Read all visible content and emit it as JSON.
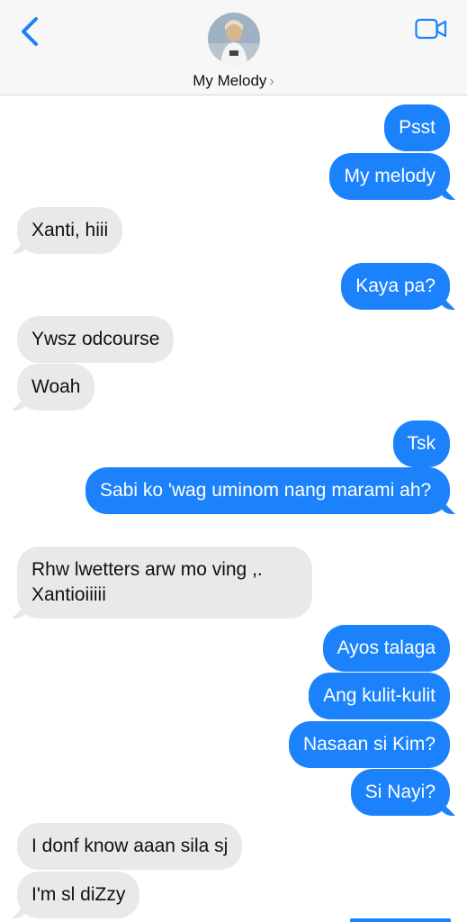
{
  "header": {
    "contact_name": "My Melody",
    "chevron": "›",
    "back_icon": "chevron-left-icon",
    "video_icon": "video-camera-icon",
    "accent": "#1b82fb"
  },
  "messages": [
    {
      "from": "me",
      "text": "Psst"
    },
    {
      "from": "me",
      "text": "My melody"
    },
    {
      "from": "them",
      "text": "Xanti, hiii"
    },
    {
      "from": "me",
      "text": "Kaya pa?"
    },
    {
      "from": "them",
      "text": "Ywsz odcourse"
    },
    {
      "from": "them",
      "text": "Woah"
    },
    {
      "from": "me",
      "text": "Tsk"
    },
    {
      "from": "me",
      "text": "Sabi ko 'wag uminom nang marami ah?"
    },
    {
      "from": "them",
      "text": "Rhw lwetters arw mo ving ,. Xantioiiiii"
    },
    {
      "from": "me",
      "text": "Ayos talaga"
    },
    {
      "from": "me",
      "text": "Ang kulit-kulit"
    },
    {
      "from": "me",
      "text": "Nasaan si Kim?"
    },
    {
      "from": "me",
      "text": "Si Nayi?"
    },
    {
      "from": "them",
      "text": "I donf know aaan sila sj"
    },
    {
      "from": "them",
      "text": "I'm sl diZzy"
    }
  ]
}
